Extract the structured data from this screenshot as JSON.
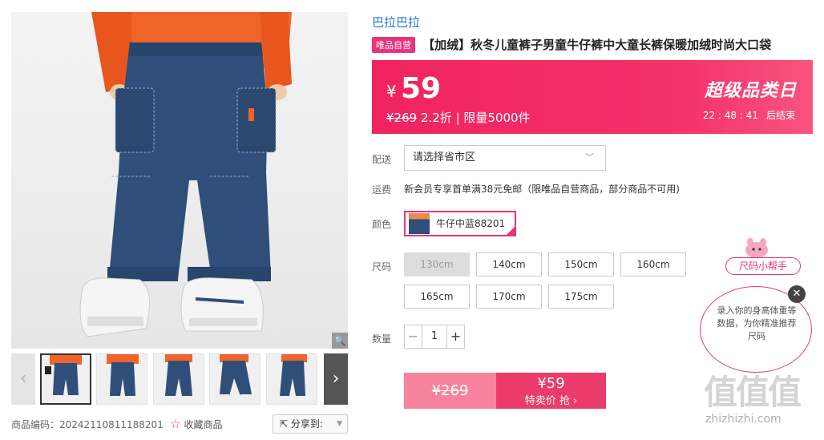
{
  "gallery": {
    "zoom_icon": "magnifier-icon",
    "sku_code": "商品编码：20242110811188201",
    "fav_label": "收藏商品",
    "share_label": "分享到:"
  },
  "brand": "巴拉巴拉",
  "vip_badge": "唯品自营",
  "title": "【加绒】秋冬儿童裤子男童牛仔裤中大童长裤保暖加绒时尚大口袋",
  "price": {
    "currency": "¥",
    "now": "59",
    "original": "¥269",
    "discount_text": " 2.2折 | 限量5000件",
    "promo_name": "超级品类日",
    "countdown": "22 : 48 : 41",
    "countdown_end": "后结束"
  },
  "delivery": {
    "label": "配送",
    "placeholder": "请选择省市区"
  },
  "shipping": {
    "label": "运费",
    "text": "新会员专享首单满38元免邮（限唯品自营商品，部分商品不可用)"
  },
  "color": {
    "label": "颜色",
    "option": "牛仔中蓝88201"
  },
  "size": {
    "label": "尺码",
    "options": [
      "130cm",
      "140cm",
      "150cm",
      "160cm",
      "165cm",
      "170cm",
      "175cm"
    ],
    "disabled": [
      "130cm"
    ]
  },
  "quantity": {
    "label": "数量",
    "value": "1"
  },
  "buy": {
    "original": "¥269",
    "price": "¥59",
    "action": "特卖价 抢 ›"
  },
  "helper": {
    "tag": "尺码小帮手",
    "text": "录入你的身高体重等数据，为你精准推荐尺码"
  },
  "watermark": {
    "big": "值值值",
    "small": "zhizhizhi.com"
  },
  "colors": {
    "accent": "#e8347a",
    "price_bar": "#f0245f",
    "brand_link": "#1a78d6"
  }
}
